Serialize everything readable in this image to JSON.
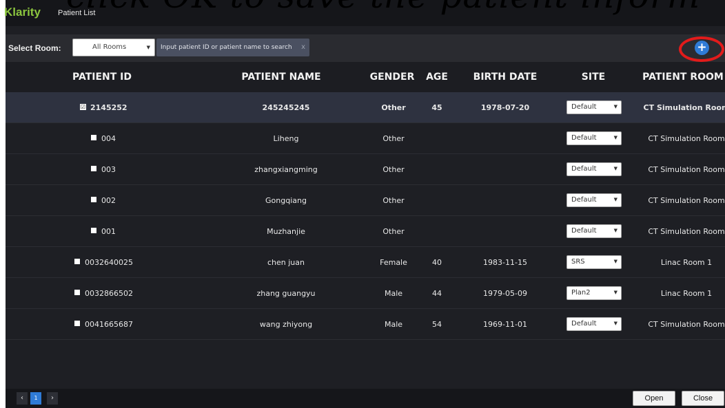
{
  "overlay": {
    "caption": "click OK to save the patient inform"
  },
  "app": {
    "logo": "Klarity",
    "title": "Patient List"
  },
  "toolbar": {
    "select_room_label": "Select Room:",
    "room_value": "All Rooms",
    "search_placeholder": "Input patient ID or patient name to search",
    "search_clear": "x",
    "add_icon": "plus-circle-icon",
    "highlight_color": "#e21b1b"
  },
  "table": {
    "headers": [
      "PATIENT ID",
      "PATIENT NAME",
      "GENDER",
      "AGE",
      "BIRTH DATE",
      "SITE",
      "PATIENT ROOM"
    ],
    "rows": [
      {
        "checked": true,
        "check_glyph": "☑",
        "id": "2145252",
        "name": "245245245",
        "gender": "Other",
        "age": "45",
        "birth": "1978-07-20",
        "site": "Default",
        "room": "CT Simulation Room"
      },
      {
        "checked": false,
        "id": "004",
        "name": "Liheng",
        "gender": "Other",
        "age": "",
        "birth": "",
        "site": "Default",
        "room": "CT Simulation Room"
      },
      {
        "checked": false,
        "id": "003",
        "name": "zhangxiangming",
        "gender": "Other",
        "age": "",
        "birth": "",
        "site": "Default",
        "room": "CT Simulation Room"
      },
      {
        "checked": false,
        "id": "002",
        "name": "Gongqiang",
        "gender": "Other",
        "age": "",
        "birth": "",
        "site": "Default",
        "room": "CT Simulation Room"
      },
      {
        "checked": false,
        "id": "001",
        "name": "Muzhanjie",
        "gender": "Other",
        "age": "",
        "birth": "",
        "site": "Default",
        "room": "CT Simulation Room"
      },
      {
        "checked": false,
        "id": "0032640025",
        "name": "chen juan",
        "gender": "Female",
        "age": "40",
        "birth": "1983-11-15",
        "site": "SRS",
        "room": "Linac Room 1"
      },
      {
        "checked": false,
        "id": "0032866502",
        "name": "zhang guangyu",
        "gender": "Male",
        "age": "44",
        "birth": "1979-05-09",
        "site": "Plan2",
        "room": "Linac Room 1"
      },
      {
        "checked": false,
        "id": "0041665687",
        "name": "wang zhiyong",
        "gender": "Male",
        "age": "54",
        "birth": "1969-11-01",
        "site": "Default",
        "room": "CT Simulation Room"
      }
    ]
  },
  "footer": {
    "prev": "‹",
    "page": "1",
    "next": "›",
    "open_label": "Open",
    "close_label": "Close"
  }
}
